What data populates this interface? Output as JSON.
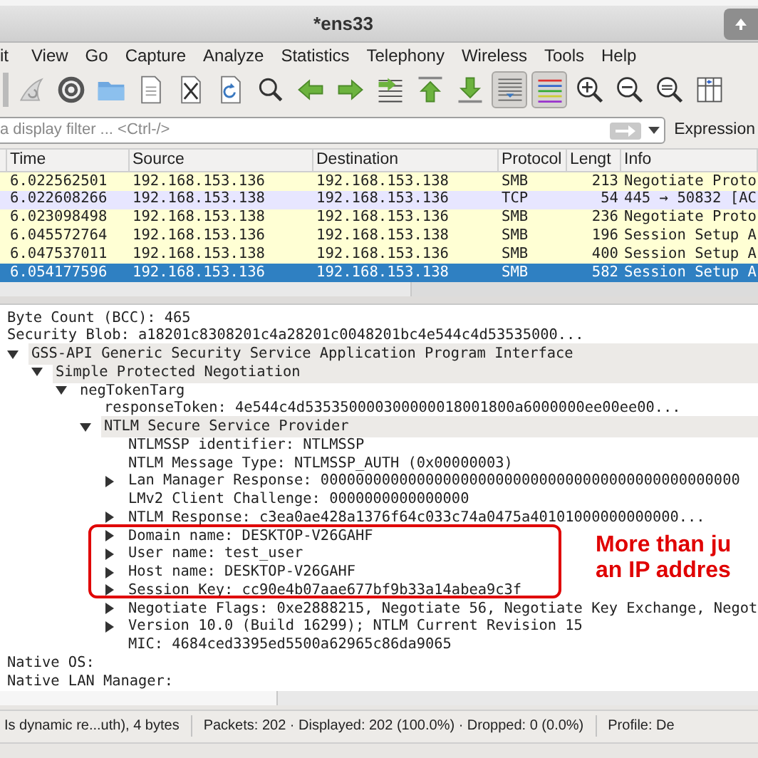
{
  "window": {
    "title": "*ens33"
  },
  "menu": [
    "it",
    "View",
    "Go",
    "Capture",
    "Analyze",
    "Statistics",
    "Telephony",
    "Wireless",
    "Tools",
    "Help"
  ],
  "toolbar": [
    {
      "kind": "fin",
      "pressed": false
    },
    {
      "kind": "gear",
      "pressed": false
    },
    {
      "kind": "folder",
      "pressed": false
    },
    {
      "kind": "file",
      "pressed": false
    },
    {
      "kind": "close",
      "pressed": false
    },
    {
      "kind": "reload",
      "pressed": false
    },
    {
      "kind": "search",
      "pressed": false
    },
    {
      "kind": "back",
      "pressed": false
    },
    {
      "kind": "forward",
      "pressed": false
    },
    {
      "kind": "jump",
      "pressed": false
    },
    {
      "kind": "top",
      "pressed": false
    },
    {
      "kind": "bottom",
      "pressed": false
    },
    {
      "kind": "autoscroll",
      "pressed": true
    },
    {
      "kind": "colorize",
      "pressed": true
    },
    {
      "kind": "zoomin",
      "pressed": false
    },
    {
      "kind": "zoomout",
      "pressed": false
    },
    {
      "kind": "zoomreset",
      "pressed": false
    },
    {
      "kind": "columns",
      "pressed": false
    }
  ],
  "filter": {
    "placeholder": "a display filter ... <Ctrl-/>",
    "expression_button": "Expression"
  },
  "packet_list": {
    "columns": [
      "Time",
      "Source",
      "Destination",
      "Protocol",
      "Lengt",
      "Info"
    ],
    "rows": [
      {
        "cells": [
          "6.022562501",
          "192.168.153.136",
          "192.168.153.138",
          "SMB",
          "213",
          "Negotiate Proto"
        ],
        "color": "#ffffd4",
        "selected": false
      },
      {
        "cells": [
          "6.022608266",
          "192.168.153.138",
          "192.168.153.136",
          "TCP",
          "54",
          "445 → 50832 [AC"
        ],
        "color": "#e7e6ff",
        "selected": false
      },
      {
        "cells": [
          "6.023098498",
          "192.168.153.138",
          "192.168.153.136",
          "SMB",
          "236",
          "Negotiate Proto"
        ],
        "color": "#ffffd4",
        "selected": false
      },
      {
        "cells": [
          "6.045572764",
          "192.168.153.136",
          "192.168.153.138",
          "SMB",
          "196",
          "Session Setup A"
        ],
        "color": "#ffffd4",
        "selected": false
      },
      {
        "cells": [
          "6.047537011",
          "192.168.153.138",
          "192.168.153.136",
          "SMB",
          "400",
          "Session Setup A"
        ],
        "color": "#ffffd4",
        "selected": false
      },
      {
        "cells": [
          "6.054177596",
          "192.168.153.136",
          "192.168.153.138",
          "SMB",
          "582",
          "Session Setup A"
        ],
        "selected": true
      }
    ]
  },
  "details": [
    {
      "label": "Byte Count (BCC): 465",
      "kind": "leaf",
      "highlighted": false
    },
    {
      "label": "Security Blob: a18201c8308201c4a28201c0048201bc4e544c4d53535000...",
      "kind": "leaf",
      "highlighted": false
    },
    {
      "label": "GSS-API Generic Security Service Application Program Interface",
      "kind": "node",
      "expanded": true,
      "highlighted": true,
      "children": [
        {
          "label": "Simple Protected Negotiation",
          "kind": "node",
          "expanded": true,
          "highlighted": true,
          "children": [
            {
              "label": "negTokenTarg",
              "kind": "node",
              "expanded": true,
              "highlighted": false,
              "children": [
                {
                  "label": "responseToken: 4e544c4d535350000300000018001800a6000000ee00ee00...",
                  "kind": "leaf",
                  "highlighted": false
                },
                {
                  "label": "NTLM Secure Service Provider",
                  "kind": "node",
                  "expanded": true,
                  "highlighted": true,
                  "children": [
                    {
                      "label": "NTLMSSP identifier: NTLMSSP",
                      "kind": "leaf",
                      "highlighted": false
                    },
                    {
                      "label": "NTLM Message Type: NTLMSSP_AUTH (0x00000003)",
                      "kind": "leaf",
                      "highlighted": false
                    },
                    {
                      "label": "Lan Manager Response: 000000000000000000000000000000000000000000000000",
                      "kind": "node",
                      "expanded": false,
                      "highlighted": false
                    },
                    {
                      "label": "LMv2 Client Challenge: 0000000000000000",
                      "kind": "leaf",
                      "highlighted": false
                    },
                    {
                      "label": "NTLM Response: c3ea0ae428a1376f64c033c74a0475a40101000000000000...",
                      "kind": "node",
                      "expanded": false,
                      "highlighted": false
                    },
                    {
                      "label": "Domain name: DESKTOP-V26GAHF",
                      "kind": "node",
                      "expanded": false,
                      "highlighted": false
                    },
                    {
                      "label": "User name: test_user",
                      "kind": "node",
                      "expanded": false,
                      "highlighted": false
                    },
                    {
                      "label": "Host name: DESKTOP-V26GAHF",
                      "kind": "node",
                      "expanded": false,
                      "highlighted": false
                    },
                    {
                      "label": "Session Key: cc90e4b07aae677bf9b33a14abea9c3f",
                      "kind": "node",
                      "expanded": false,
                      "highlighted": false
                    },
                    {
                      "label": "Negotiate Flags: 0xe2888215, Negotiate 56, Negotiate Key Exchange, Negot",
                      "kind": "node",
                      "expanded": false,
                      "highlighted": false
                    },
                    {
                      "label": "Version 10.0 (Build 16299); NTLM Current Revision 15",
                      "kind": "node",
                      "expanded": false,
                      "highlighted": false
                    },
                    {
                      "label": "MIC: 4684ced3395ed5500a62965c86da9065",
                      "kind": "leaf",
                      "highlighted": false
                    }
                  ]
                }
              ]
            }
          ]
        }
      ]
    },
    {
      "label": "Native OS:",
      "kind": "leaf",
      "highlighted": false
    },
    {
      "label": "Native LAN Manager:",
      "kind": "leaf",
      "highlighted": false
    }
  ],
  "annotation": {
    "lines": [
      "More than ju",
      "an IP addres"
    ]
  },
  "status_bar": [
    "Is dynamic re...uth), 4 bytes",
    "Packets: 202 · Displayed: 202 (100.0%) · Dropped: 0 (0.0%)",
    "Profile: De"
  ]
}
